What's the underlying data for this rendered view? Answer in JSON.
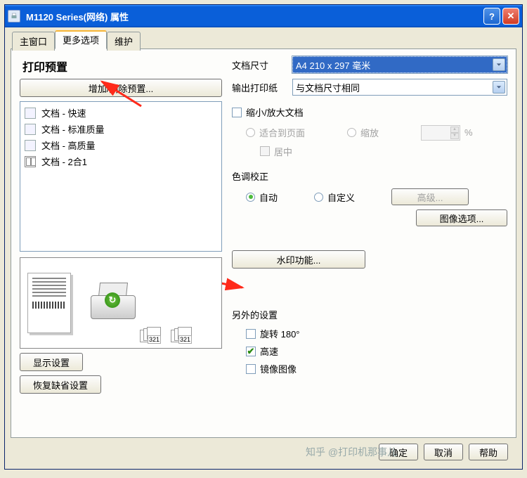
{
  "title": "M1120 Series(网络) 属性",
  "tabs": {
    "main": "主窗口",
    "more": "更多选项",
    "maint": "维护"
  },
  "presets": {
    "heading": "打印预置",
    "add_btn": "增加/删除预置...",
    "items": [
      {
        "label": "文档 - 快速"
      },
      {
        "label": "文档 - 标准质量"
      },
      {
        "label": "文档 - 高质量"
      },
      {
        "label": "文档 - 2合1"
      }
    ],
    "show_btn": "显示设置",
    "restore_btn": "恢复缺省设置"
  },
  "doc": {
    "size_label": "文档尺寸",
    "size_value": "A4 210 x 297 毫米",
    "output_label": "输出打印纸",
    "output_value": "与文档尺寸相同"
  },
  "scale": {
    "checkbox": "缩小/放大文档",
    "fit": "适合到页面",
    "zoom": "缩放",
    "center": "居中",
    "percent": "%"
  },
  "color": {
    "heading": "色调校正",
    "auto": "自动",
    "custom": "自定义",
    "advanced_btn": "高级...",
    "image_opts_btn": "图像选项..."
  },
  "watermark_btn": "水印功能...",
  "extra": {
    "heading": "另外的设置",
    "rotate": "旋转 180°",
    "fast": "高速",
    "mirror": "镜像图像"
  },
  "footer": {
    "ok": "确定",
    "cancel": "取消",
    "help": "帮助",
    "wm": "知乎 @打印机那事儿"
  }
}
